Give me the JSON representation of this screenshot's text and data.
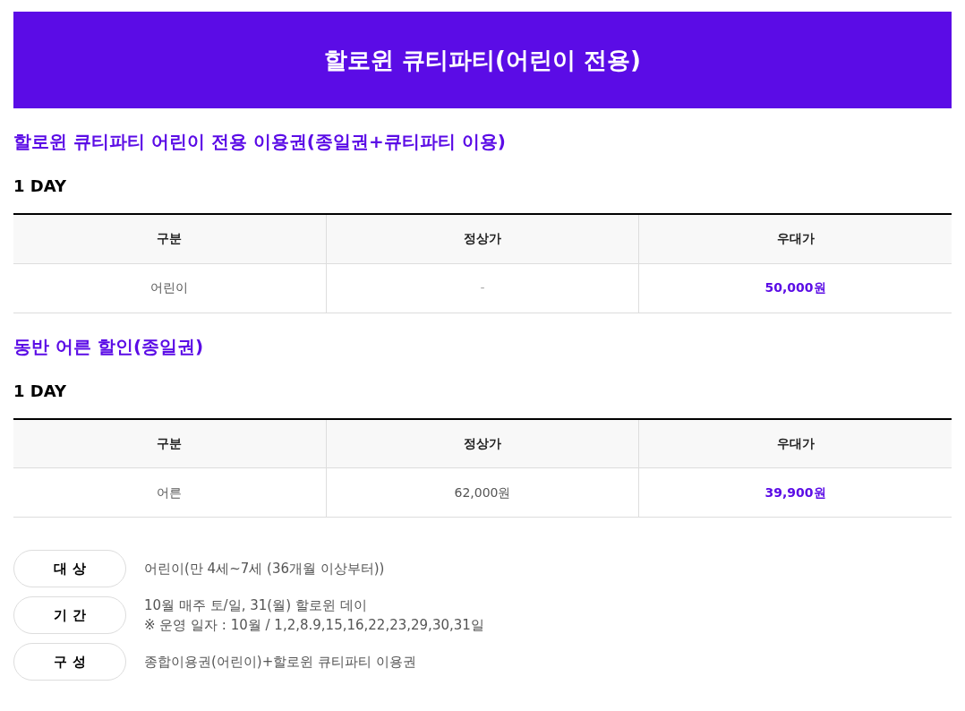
{
  "banner": {
    "title": "할로윈 큐티파티(어린이 전용)"
  },
  "sections": [
    {
      "title": "할로윈 큐티파티 어린이 전용 이용권(종일권+큐티파티 이용)",
      "subtitle": "1 DAY",
      "table": {
        "columns": [
          "구분",
          "정상가",
          "우대가"
        ],
        "rows": [
          [
            {
              "text": "어린이",
              "kind": "plain"
            },
            {
              "text": "-",
              "kind": "muted"
            },
            {
              "text": "50,000원",
              "kind": "price"
            }
          ]
        ]
      }
    },
    {
      "title": "동반 어른 할인(종일권)",
      "subtitle": "1 DAY",
      "table": {
        "columns": [
          "구분",
          "정상가",
          "우대가"
        ],
        "rows": [
          [
            {
              "text": "어른",
              "kind": "plain"
            },
            {
              "text": "62,000원",
              "kind": "plain"
            },
            {
              "text": "39,900원",
              "kind": "price"
            }
          ]
        ]
      }
    }
  ],
  "info": [
    {
      "label": "대 상",
      "lines": [
        "어린이(만 4세~7세 (36개월 이상부터))"
      ]
    },
    {
      "label": "기 간",
      "lines": [
        "10월 매주 토/일, 31(월) 할로윈 데이",
        "※ 운영 일자 : 10월 / 1,2,8.9,15,16,22,23,29,30,31일"
      ]
    },
    {
      "label": "구 성",
      "lines": [
        "종합이용권(어린이)+할로윈 큐티파티 이용권"
      ]
    }
  ]
}
